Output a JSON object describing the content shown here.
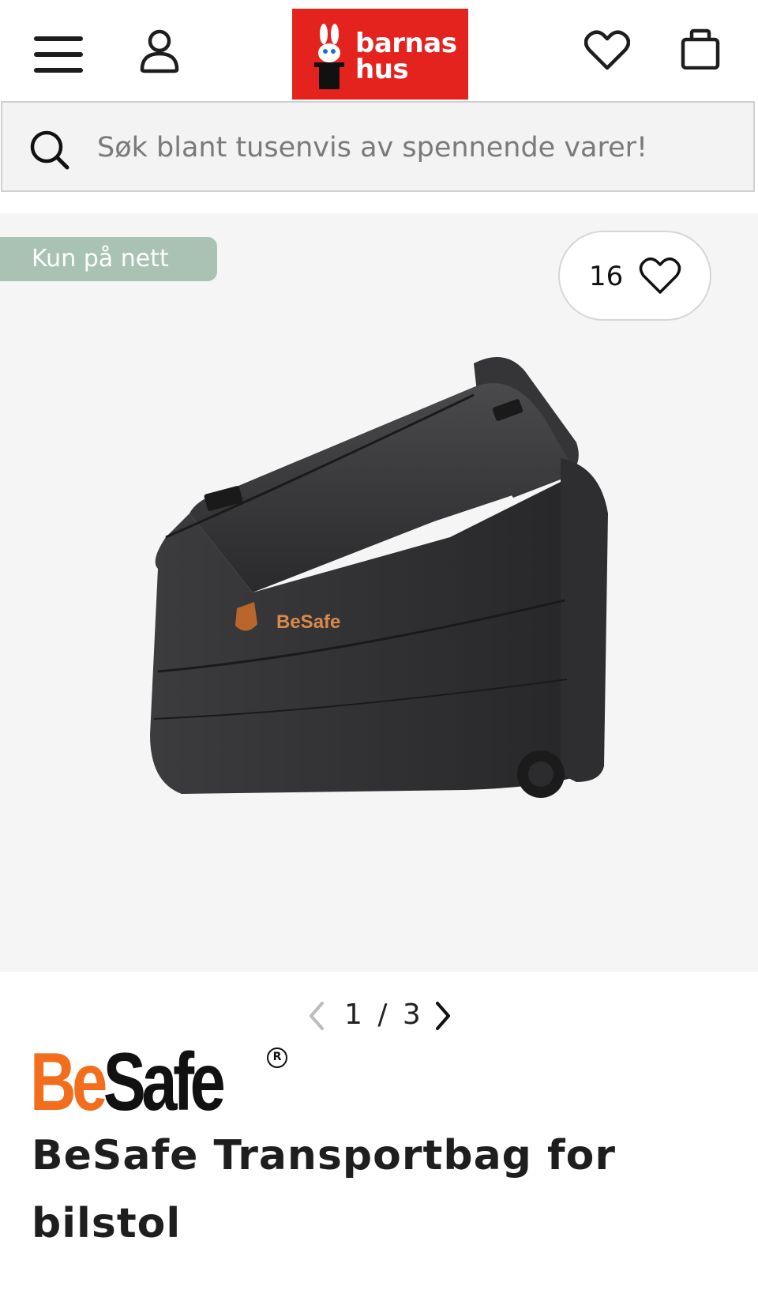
{
  "header": {
    "logo_line1": "barnas",
    "logo_line2": "hus"
  },
  "search": {
    "placeholder": "Søk blant tusenvis av spennende varer!"
  },
  "gallery": {
    "badge": "Kun på nett",
    "favorites_count": "16",
    "pager": "1 / 3"
  },
  "brand": {
    "part1": "Be",
    "part2": "Safe",
    "image_logo_text": "BeSafe"
  },
  "product": {
    "title": "BeSafe Transportbag for bilstol"
  },
  "colors": {
    "logo_bg": "#e4231f",
    "badge_bg": "#a9c2b3",
    "brand_orange": "#f26d1c"
  }
}
